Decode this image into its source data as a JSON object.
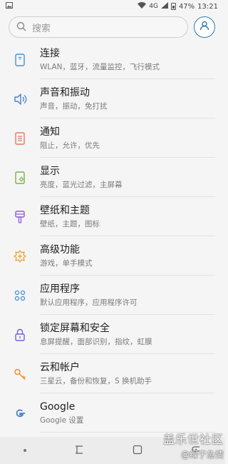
{
  "status": {
    "network": "4G",
    "battery": "47%",
    "time": "13:21"
  },
  "search": {
    "placeholder": "搜索"
  },
  "items": [
    {
      "title": "连接",
      "subtitle": "WLAN，蓝牙，流量监控，飞行模式",
      "icon": "connections-icon",
      "color": "#4a8fd8"
    },
    {
      "title": "声音和振动",
      "subtitle": "声音，振动，免打扰",
      "icon": "sound-icon",
      "color": "#4a7fd0"
    },
    {
      "title": "通知",
      "subtitle": "阻止，允许，优先",
      "icon": "notifications-icon",
      "color": "#e07a5f"
    },
    {
      "title": "显示",
      "subtitle": "亮度，蓝光过滤，主屏幕",
      "icon": "display-icon",
      "color": "#7bb342"
    },
    {
      "title": "壁纸和主题",
      "subtitle": "壁纸，主题，图标",
      "icon": "wallpaper-icon",
      "color": "#8e5bd8"
    },
    {
      "title": "高级功能",
      "subtitle": "游戏，单手模式",
      "icon": "advanced-icon",
      "color": "#f0a030"
    },
    {
      "title": "应用程序",
      "subtitle": "默认应用程序，应用程序许可",
      "icon": "apps-icon",
      "color": "#4a8fd8"
    },
    {
      "title": "锁定屏幕和安全",
      "subtitle": "息屏提醒，面部识别，指纹，虹膜",
      "icon": "lock-icon",
      "color": "#7b5fd0"
    },
    {
      "title": "云和帐户",
      "subtitle": "三星云，备份和恢复，S 换机助手",
      "icon": "key-icon",
      "color": "#f08a30"
    },
    {
      "title": "Google",
      "subtitle": "Google 设置",
      "icon": "google-icon",
      "color": "#4a7fd0"
    }
  ],
  "watermark": {
    "line1": "盖乐世社区",
    "line2": "@绿于急情"
  }
}
